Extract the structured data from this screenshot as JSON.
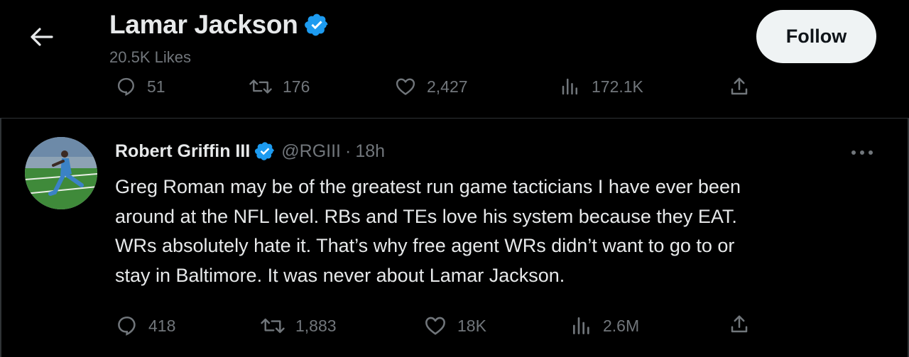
{
  "header": {
    "name": "Lamar Jackson",
    "subtitle": "20.5K Likes",
    "follow_label": "Follow"
  },
  "top_actions": {
    "replies": "51",
    "retweets": "176",
    "likes": "2,427",
    "views": "172.1K"
  },
  "tweet": {
    "author": "Robert Griffin III",
    "handle": "@RGIII",
    "separator": "·",
    "time": "18h",
    "lines": [
      "Greg Roman may be of the greatest run game tacticians I have ever been",
      "around at the NFL level. RBs and TEs love his system because they EAT.",
      "WRs absolutely hate it. That’s why free agent WRs didn’t want to go to or",
      "stay in Baltimore. It was never about Lamar Jackson."
    ],
    "actions": {
      "replies": "418",
      "retweets": "1,883",
      "likes": "18K",
      "views": "2.6M"
    }
  },
  "colors": {
    "background": "#000000",
    "text": "#e7e9ea",
    "muted": "#71767b",
    "verified": "#1d9bf0",
    "divider": "#2f3336"
  },
  "icons": [
    "back-arrow-icon",
    "verified-badge-icon",
    "reply-icon",
    "retweet-icon",
    "like-icon",
    "views-icon",
    "share-icon",
    "more-icon"
  ]
}
